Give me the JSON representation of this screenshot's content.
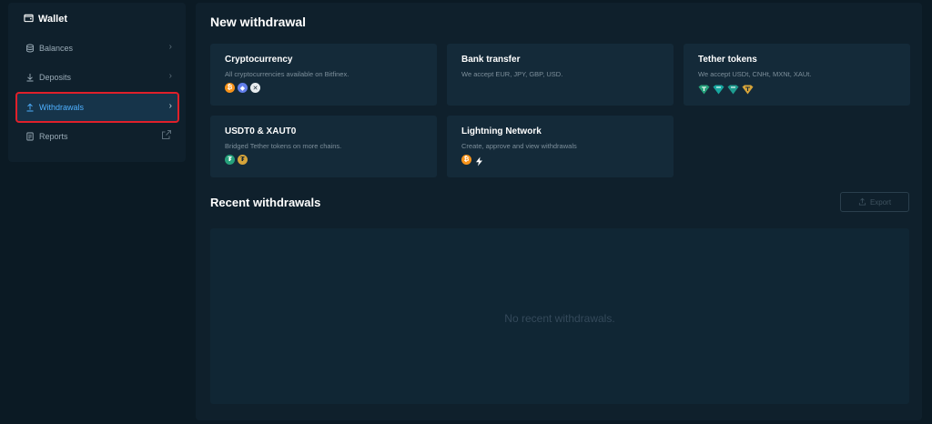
{
  "sidebar": {
    "title": "Wallet",
    "items": [
      {
        "label": "Balances"
      },
      {
        "label": "Deposits"
      },
      {
        "label": "Withdrawals"
      },
      {
        "label": "Reports"
      }
    ]
  },
  "main": {
    "heading": "New withdrawal",
    "cards": [
      {
        "title": "Cryptocurrency",
        "desc": "All cryptocurrencies available on Bitfinex."
      },
      {
        "title": "Bank transfer",
        "desc": "We accept EUR, JPY, GBP, USD."
      },
      {
        "title": "Tether tokens",
        "desc": "We accept USDt, CNHt, MXNt, XAUt."
      },
      {
        "title": "USDT0 & XAUT0",
        "desc": "Bridged Tether tokens on more chains."
      },
      {
        "title": "Lightning Network",
        "desc": "Create, approve and view withdrawals"
      }
    ],
    "recent_heading": "Recent withdrawals",
    "export_label": "Export",
    "empty_text": "No recent withdrawals."
  },
  "colors": {
    "accent": "#4fb0ff",
    "highlight_border": "#e0202a",
    "btc": "#f7931a",
    "eth": "#627eea",
    "tether": "#26a17b",
    "gold": "#d6a43a"
  }
}
